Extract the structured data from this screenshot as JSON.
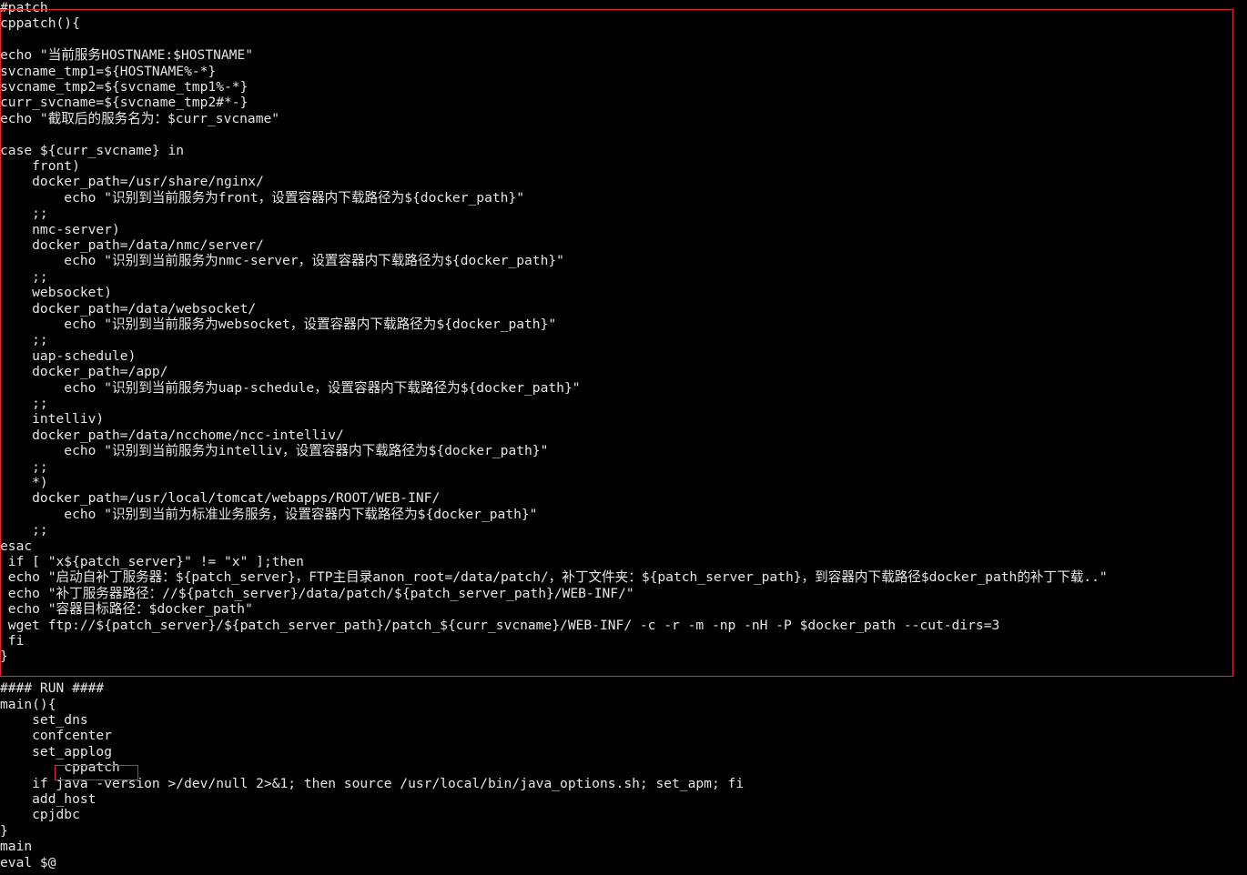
{
  "highlight_color": "#e0292e",
  "text_color": "#e6e6e6",
  "background_color": "#000000",
  "lines": [
    "#patch",
    "cppatch(){",
    "",
    "echo \"当前服务HOSTNAME:$HOSTNAME\"",
    "svcname_tmp1=${HOSTNAME%-*}",
    "svcname_tmp2=${svcname_tmp1%-*}",
    "curr_svcname=${svcname_tmp2#*-}",
    "echo \"截取后的服务名为：$curr_svcname\"",
    "",
    "case ${curr_svcname} in",
    "    front)",
    "    docker_path=/usr/share/nginx/",
    "        echo \"识别到当前服务为front，设置容器内下载路径为${docker_path}\"",
    "    ;;",
    "    nmc-server)",
    "    docker_path=/data/nmc/server/",
    "        echo \"识别到当前服务为nmc-server，设置容器内下载路径为${docker_path}\"",
    "    ;;",
    "    websocket)",
    "    docker_path=/data/websocket/",
    "        echo \"识别到当前服务为websocket，设置容器内下载路径为${docker_path}\"",
    "    ;;",
    "    uap-schedule)",
    "    docker_path=/app/",
    "        echo \"识别到当前服务为uap-schedule，设置容器内下载路径为${docker_path}\"",
    "    ;;",
    "    intelliv)",
    "    docker_path=/data/ncchome/ncc-intelliv/",
    "        echo \"识别到当前服务为intelliv，设置容器内下载路径为${docker_path}\"",
    "    ;;",
    "    *)",
    "    docker_path=/usr/local/tomcat/webapps/ROOT/WEB-INF/",
    "        echo \"识别到当前为标准业务服务，设置容器内下载路径为${docker_path}\"",
    "    ;;",
    "esac",
    " if [ \"x${patch_server}\" != \"x\" ];then",
    " echo \"启动自补丁服务器：${patch_server}，FTP主目录anon_root=/data/patch/，补丁文件夹：${patch_server_path}，到容器内下载路径$docker_path的补丁下载..\"",
    " echo \"补丁服务器路径：//${patch_server}/data/patch/${patch_server_path}/WEB-INF/\"",
    " echo \"容器目标路径：$docker_path\"",
    " wget ftp://${patch_server}/${patch_server_path}/patch_${curr_svcname}/WEB-INF/ -c -r -m -np -nH -P $docker_path --cut-dirs=3",
    " fi",
    "}",
    "",
    "#### RUN ####",
    "main(){",
    "    set_dns",
    "    confcenter",
    "    set_applog",
    "        cppatch",
    "    if java -version >/dev/null 2>&1; then source /usr/local/bin/java_options.sh; set_apm; fi",
    "    add_host",
    "    cpjdbc",
    "}",
    "main",
    "eval $@"
  ]
}
